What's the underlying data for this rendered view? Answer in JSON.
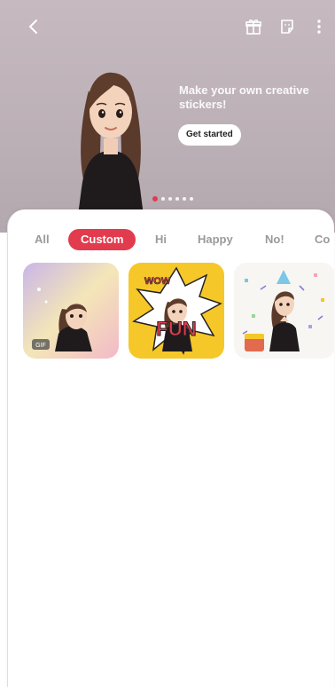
{
  "banner": {
    "promo_text": "Make your own creative stickers!",
    "cta_label": "Get started",
    "page_count": 6,
    "current_page": 1
  },
  "topbar": {
    "back_icon": "chevron-left-icon",
    "gift_icon": "gift-icon",
    "sticker_icon": "sticker-icon",
    "more_icon": "more-vertical-icon"
  },
  "tabs": [
    {
      "label": "All"
    },
    {
      "label": "Custom"
    },
    {
      "label": "Hi"
    },
    {
      "label": "Happy"
    },
    {
      "label": "No!"
    },
    {
      "label": "Co"
    }
  ],
  "selected_tab": "Custom",
  "stickers": [
    {
      "badge": "GIF"
    },
    {
      "caption_1": "WOW",
      "caption_2": "FUN"
    },
    {
      "caption": "party"
    }
  ],
  "colors": {
    "accent": "#e23b4d",
    "hero_bg": "#c6bac0",
    "tab_inactive": "#9a9a9a"
  }
}
